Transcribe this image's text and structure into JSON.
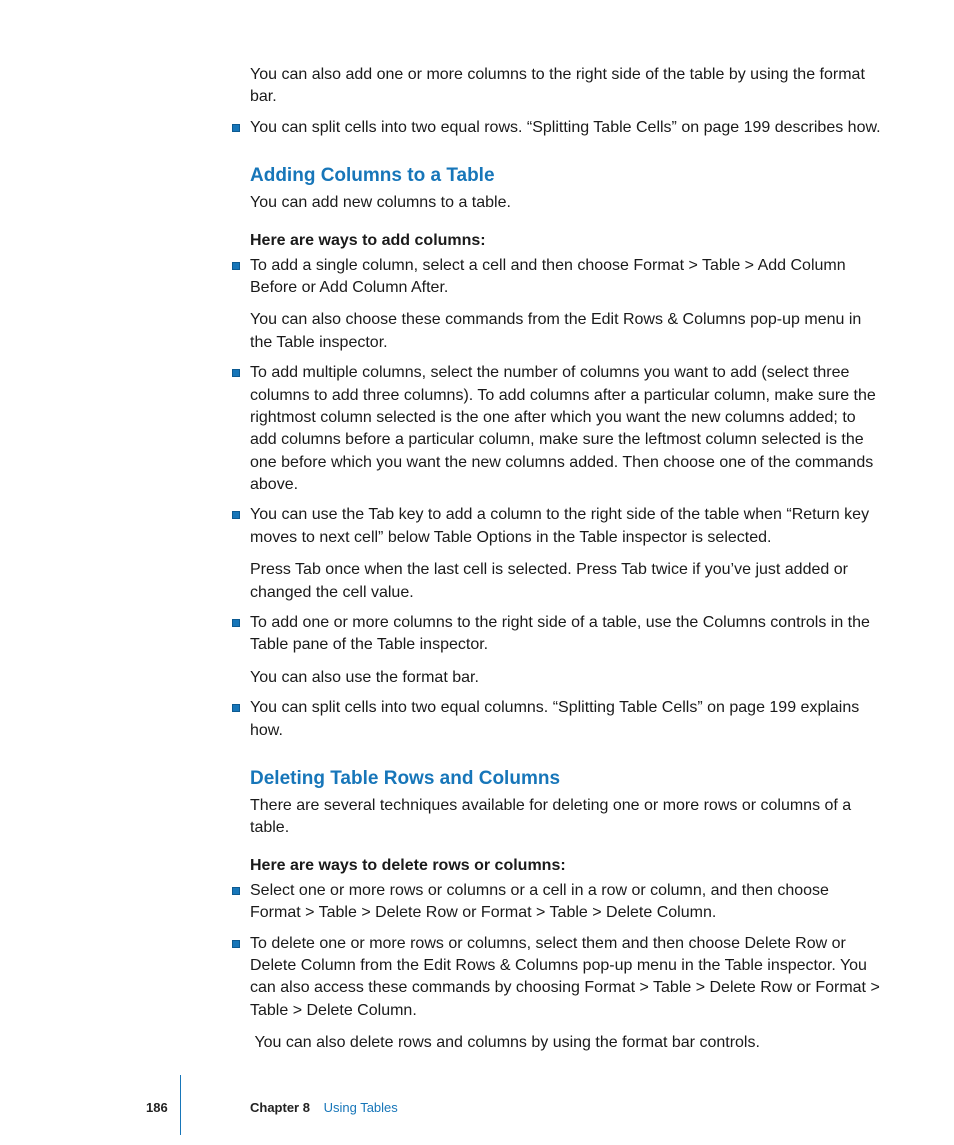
{
  "intro": {
    "p1": "You can also add one or more columns to the right side of the table by using the format bar.",
    "b1": "You can split cells into two equal rows. “Splitting Table Cells” on page 199 describes how."
  },
  "section1": {
    "heading": "Adding Columns to a Table",
    "sub": "You can add new columns to a table.",
    "bold": "Here are ways to add columns:",
    "items": {
      "0": {
        "main": "To add a single column, select a cell and then choose Format > Table > Add Column Before or Add Column After.",
        "extra": "You can also choose these commands from the Edit Rows & Columns pop-up menu in the Table inspector."
      },
      "1": {
        "main": "To add multiple columns, select the number of columns you want to add (select three columns to add three columns). To add columns after a particular column, make sure the rightmost column selected is the one after which you want the new columns added; to add columns before a particular column, make sure the leftmost column selected is the one before which you want the new columns added. Then choose one of the commands above."
      },
      "2": {
        "main": "You can use the Tab key to add a column to the right side of the table when “Return key moves to next cell” below Table Options in the Table inspector is selected.",
        "extra": "Press Tab once when the last cell is selected. Press Tab twice if you’ve just added or changed the cell value."
      },
      "3": {
        "main": "To add one or more columns to the right side of a table, use the Columns controls in the Table pane of the Table inspector.",
        "extra": "You can also use the format bar."
      },
      "4": {
        "main": "You can split cells into two equal columns. “Splitting Table Cells” on page 199 explains how."
      }
    }
  },
  "section2": {
    "heading": "Deleting Table Rows and Columns",
    "sub": "There are several techniques available for deleting one or more rows or columns of a table.",
    "bold": "Here are ways to delete rows or columns:",
    "items": {
      "0": {
        "main": "Select one or more rows or columns or a cell in a row or column, and then choose Format > Table > Delete Row or Format > Table > Delete Column."
      },
      "1": {
        "main": "To delete one or more rows or columns, select them and then choose Delete Row or Delete Column from the Edit Rows & Columns pop-up menu in the Table inspector. You can also access these commands by choosing Format > Table > Delete Row or Format > Table > Delete Column.",
        "extra": " You can also delete rows and columns by using the format bar controls."
      }
    }
  },
  "footer": {
    "page": "186",
    "chapter_label": "Chapter 8",
    "chapter_title": "Using Tables"
  }
}
